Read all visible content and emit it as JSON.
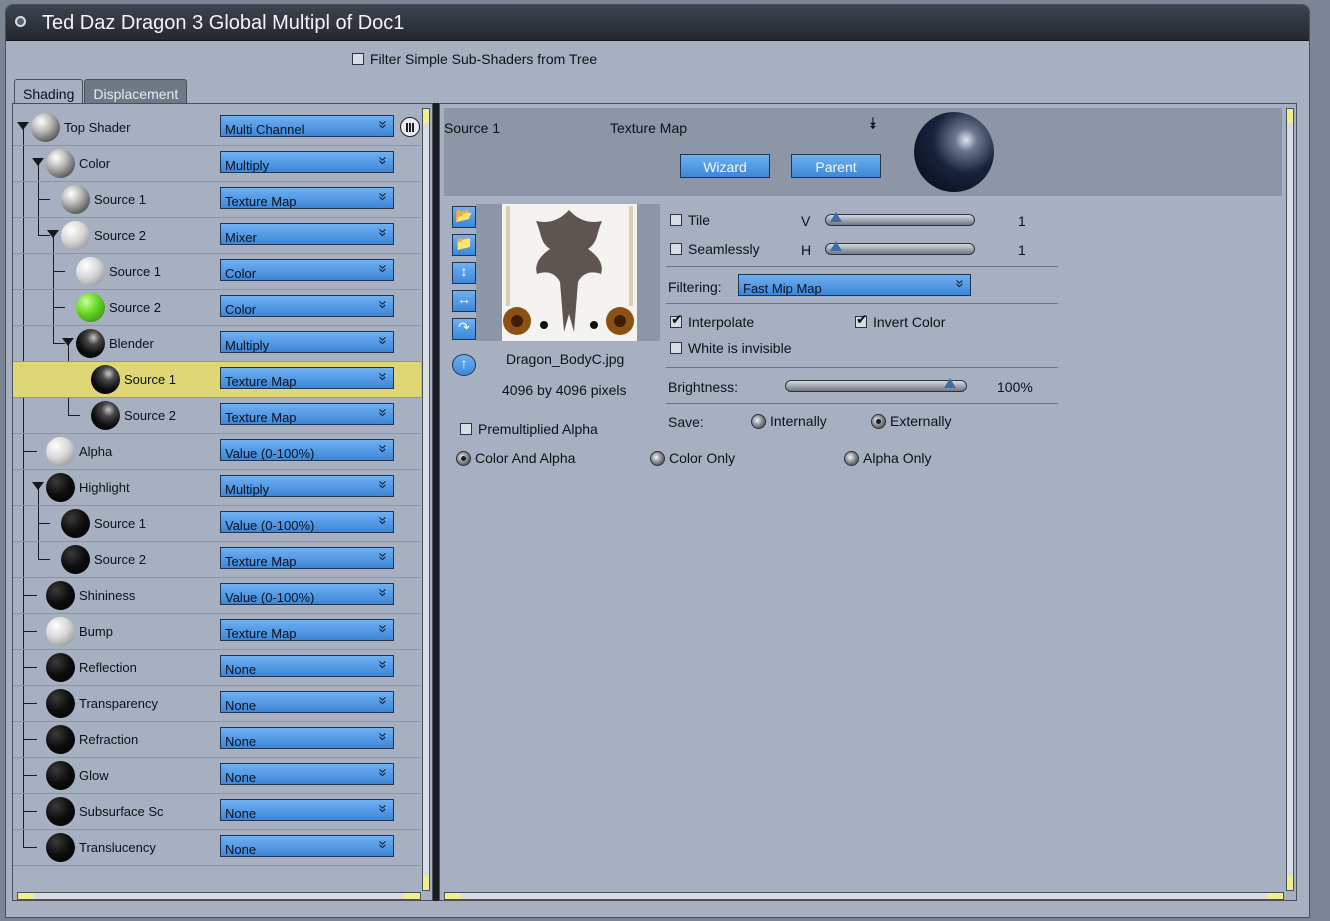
{
  "window": {
    "title": "Ted Daz Dragon 3 Global Multipl of Doc1"
  },
  "filter_option": {
    "label": "Filter Simple Sub-Shaders from Tree",
    "checked": false
  },
  "tabs": [
    {
      "label": "Shading",
      "active": true
    },
    {
      "label": "Displacement",
      "active": false
    }
  ],
  "tree": [
    {
      "label": "Top Shader",
      "value": "Multi Channel",
      "ball": "mixed"
    },
    {
      "label": "Color",
      "value": "Multiply",
      "ball": "mixed"
    },
    {
      "label": "Source 1",
      "value": "Texture Map",
      "ball": "mixed"
    },
    {
      "label": "Source 2",
      "value": "Mixer",
      "ball": "white"
    },
    {
      "label": "Source 1",
      "value": "Color",
      "ball": "white"
    },
    {
      "label": "Source 2",
      "value": "Color",
      "ball": "green"
    },
    {
      "label": "Blender",
      "value": "Multiply",
      "ball": "dark"
    },
    {
      "label": "Source 1",
      "value": "Texture Map",
      "ball": "dark",
      "selected": true
    },
    {
      "label": "Source 2",
      "value": "Texture Map",
      "ball": "dark"
    },
    {
      "label": "Alpha",
      "value": "Value (0-100%)",
      "ball": "white"
    },
    {
      "label": "Highlight",
      "value": "Multiply",
      "ball": "black"
    },
    {
      "label": "Source 1",
      "value": "Value (0-100%)",
      "ball": "black"
    },
    {
      "label": "Source 2",
      "value": "Texture Map",
      "ball": "black"
    },
    {
      "label": "Shininess",
      "value": "Value (0-100%)",
      "ball": "black"
    },
    {
      "label": "Bump",
      "value": "Texture Map",
      "ball": "white"
    },
    {
      "label": "Reflection",
      "value": "None",
      "ball": "black"
    },
    {
      "label": "Transparency",
      "value": "None",
      "ball": "black"
    },
    {
      "label": "Refraction",
      "value": "None",
      "ball": "black"
    },
    {
      "label": "Glow",
      "value": "None",
      "ball": "black"
    },
    {
      "label": "Subsurface Sc",
      "value": "None",
      "ball": "black"
    },
    {
      "label": "Translucency",
      "value": "None",
      "ball": "black"
    }
  ],
  "node": {
    "name": "Source 1",
    "type": "Texture Map",
    "wizard_label": "Wizard",
    "parent_label": "Parent"
  },
  "texture": {
    "filename": "Dragon_BodyC.jpg",
    "size": "4096 by 4096 pixels",
    "premultiplied_alpha_label": "Premultiplied Alpha",
    "premultiplied_alpha": false
  },
  "channel_options": [
    {
      "label": "Color And Alpha",
      "selected": true
    },
    {
      "label": "Color Only",
      "selected": false
    },
    {
      "label": "Alpha Only",
      "selected": false
    }
  ],
  "tile": {
    "label": "Tile",
    "checked": false,
    "v_label": "V",
    "v_value": "1"
  },
  "seamlessly": {
    "label": "Seamlessly",
    "checked": false,
    "h_label": "H",
    "h_value": "1"
  },
  "filtering": {
    "label": "Filtering:",
    "value": "Fast Mip Map"
  },
  "interpolate": {
    "label": "Interpolate",
    "checked": true
  },
  "invert_color": {
    "label": "Invert Color",
    "checked": true
  },
  "white_invisible": {
    "label": "White is invisible",
    "checked": false
  },
  "brightness": {
    "label": "Brightness:",
    "value": "100%",
    "level": 1.0
  },
  "save": {
    "label": "Save:",
    "options": [
      {
        "label": "Internally",
        "selected": false
      },
      {
        "label": "Externally",
        "selected": true
      }
    ]
  },
  "colors": {
    "accent": "#4a92e0",
    "panel": "#a7b0c0",
    "selection": "#dfd776"
  }
}
